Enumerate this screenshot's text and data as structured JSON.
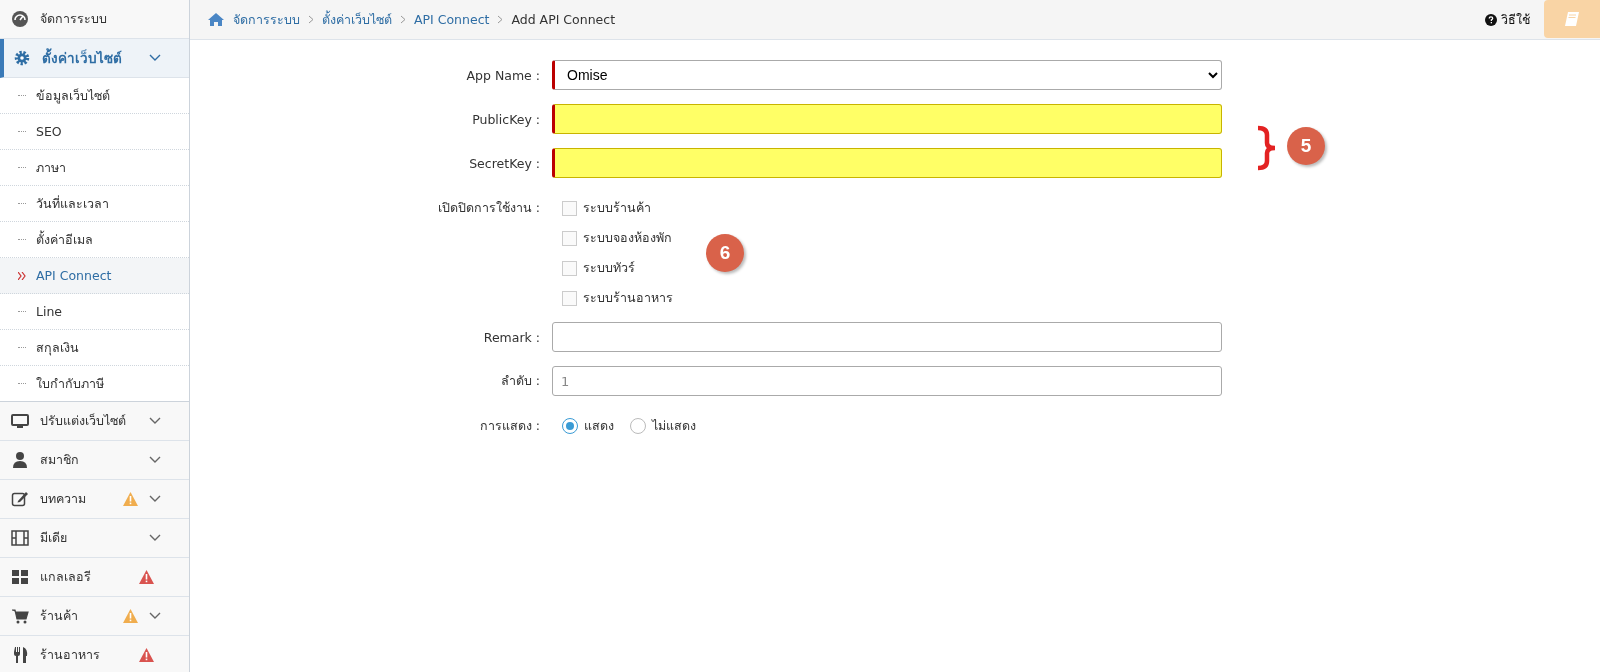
{
  "sidebar": {
    "items": [
      {
        "label": "จัดการระบบ"
      },
      {
        "label": "ตั้งค่าเว็บไซต์",
        "expanded": true,
        "children": [
          {
            "label": "ข้อมูลเว็บไซต์",
            "selected": false
          },
          {
            "label": "SEO",
            "selected": false
          },
          {
            "label": "ภาษา",
            "selected": false
          },
          {
            "label": "วันที่และเวลา",
            "selected": false
          },
          {
            "label": "ตั้งค่าอีเมล",
            "selected": false
          },
          {
            "label": "API Connect",
            "selected": true
          },
          {
            "label": "Line",
            "selected": false
          },
          {
            "label": "สกุลเงิน",
            "selected": false
          },
          {
            "label": "ใบกำกับภาษี",
            "selected": false
          }
        ]
      },
      {
        "label": "ปรับแต่งเว็บไซต์",
        "expanded": false
      },
      {
        "label": "สมาชิก",
        "expanded": false
      },
      {
        "label": "บทความ",
        "expanded": false,
        "color": "#f0ad4e"
      },
      {
        "label": "มีเดีย",
        "expanded": false
      },
      {
        "label": "แกลเลอรี",
        "color": "#d9534f"
      },
      {
        "label": "ร้านค้า",
        "expanded": false,
        "color": "#f0ad4e"
      },
      {
        "label": "ร้านอาหาร",
        "color": "#d9534f"
      }
    ]
  },
  "breadcrumb": [
    "จัดการระบบ",
    "ตั้งค่าเว็บไซต์",
    "API Connect",
    "Add API Connect"
  ],
  "help_link": "วิธีใช้",
  "form": {
    "fields": [
      {
        "kind": "select",
        "label": "App Name :",
        "value": "Omise",
        "required": true,
        "highlighted": false
      },
      {
        "kind": "text",
        "label": "PublicKey :",
        "required": true,
        "highlighted": true
      },
      {
        "kind": "text",
        "label": "SecretKey :",
        "required": true,
        "highlighted": true
      },
      {
        "kind": "checks",
        "label": "เปิดปิดการใช้งาน :",
        "options": [
          {
            "label": "ระบบร้านค้า",
            "checked": false
          },
          {
            "label": "ระบบจองห้องพัก",
            "checked": false
          },
          {
            "label": "ระบบทัวร์",
            "checked": false
          },
          {
            "label": "ระบบร้านอาหาร",
            "checked": false
          }
        ]
      },
      {
        "kind": "text",
        "label": "Remark :",
        "required": false,
        "highlighted": false
      },
      {
        "kind": "text",
        "label": "ลำดับ :",
        "placeholder": "1",
        "required": false,
        "highlighted": false
      },
      {
        "kind": "radios",
        "label": "การแสดง :",
        "options": [
          {
            "label": "แสดง",
            "selected": true
          },
          {
            "label": "ไม่แสดง",
            "selected": false
          }
        ]
      }
    ]
  },
  "annotations": [
    {
      "kind": "brace",
      "label": "5"
    },
    {
      "kind": "plain",
      "label": "6"
    }
  ]
}
